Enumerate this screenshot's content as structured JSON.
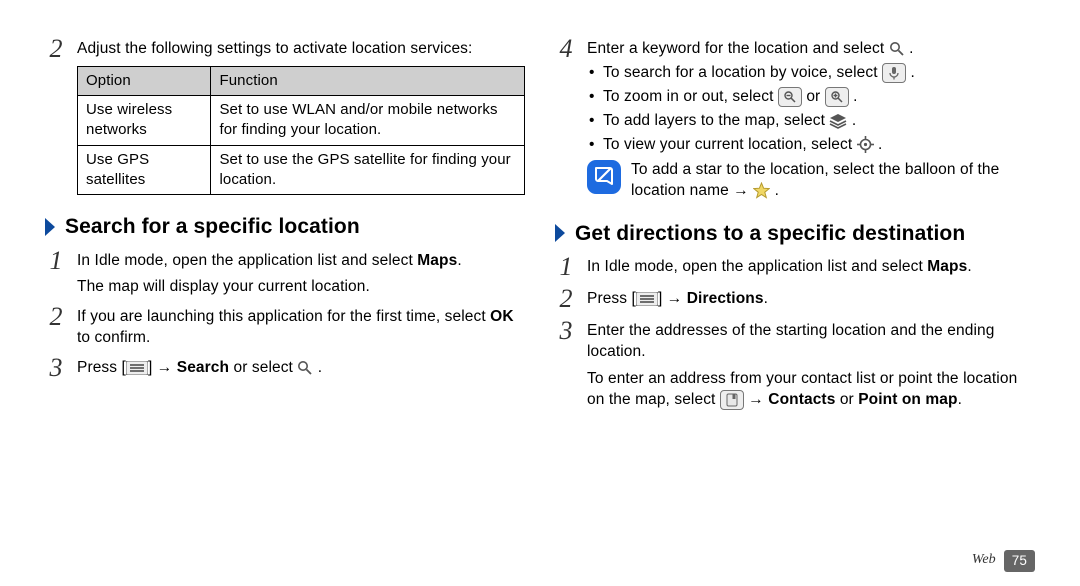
{
  "left": {
    "s2": "Adjust the following settings to activate location services:",
    "table": {
      "h1": "Option",
      "h2": "Function",
      "r1c1": "Use wireless networks",
      "r1c2": "Set to use WLAN and/or mobile networks for finding your location.",
      "r2c1": "Use GPS satellites",
      "r2c2": "Set to use the GPS satellite for finding your location."
    },
    "head": "Search for a specific location",
    "s_1a": "In Idle mode, open the application list and select ",
    "s_1b": "Maps",
    "s_1c": ".",
    "s_1d": "The map will display your current location.",
    "s_2a": "If you are launching this application for the first time, select ",
    "s_2b": "OK",
    "s_2c": " to confirm.",
    "s_3a": "Press [",
    "s_3b": "] → ",
    "s_3c": "Search",
    "s_3d": " or select "
  },
  "right": {
    "s4": "Enter a keyword for the location and select ",
    "b1": "To search for a location by voice, select ",
    "b2a": "To zoom in or out, select ",
    "b2b": " or ",
    "b3": "To add layers to the map, select ",
    "b4": "To view your current location, select ",
    "note1": "To add a star to the location, select the balloon of the location name → ",
    "head": "Get directions to a specific destination",
    "s_1a": "In Idle mode, open the application list and select ",
    "s_1b": "Maps",
    "s_1c": ".",
    "s_2a": "Press [",
    "s_2b": "] → ",
    "s_2c": "Directions",
    "s_2d": ".",
    "s_3": "Enter the addresses of the starting location and the ending location.",
    "s_3x1": "To enter an address from your contact list or point the location on the map, select ",
    "s_3x2": " → ",
    "s_3x3": "Contacts",
    "s_3x4": " or ",
    "s_3x5": "Point on map",
    "s_3x6": "."
  },
  "footer": {
    "section": "Web",
    "page": "75"
  }
}
